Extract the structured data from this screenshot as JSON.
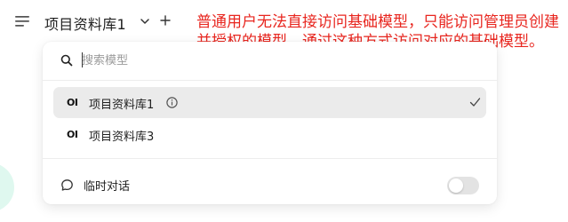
{
  "header": {
    "kb_title": "项目资料库1",
    "menu_icon": "hamburger-icon",
    "dropdown_icon": "chevron-down-icon",
    "add_icon": "plus-icon"
  },
  "annotation": {
    "text": "普通用户无法直接访问基础模型，只能访问管理员创建并授权的模型，通过这种方式访问对应的基础模型。",
    "color": "#e8261f"
  },
  "dropdown": {
    "search": {
      "placeholder": "搜索模型",
      "value": ""
    },
    "items": [
      {
        "logo": "OI",
        "label": "项目资料库1",
        "selected": true,
        "has_info": true
      },
      {
        "logo": "OI",
        "label": "项目资料库3",
        "selected": false,
        "has_info": false
      }
    ],
    "temp_chat": {
      "label": "临时对话",
      "enabled": false
    }
  }
}
